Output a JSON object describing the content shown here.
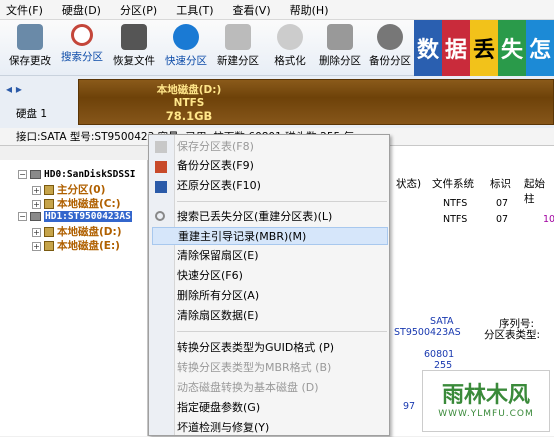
{
  "menu": [
    "文件(F)",
    "硬盘(D)",
    "分区(P)",
    "工具(T)",
    "查看(V)",
    "帮助(H)"
  ],
  "toolbar": [
    {
      "label": "保存更改",
      "color": "#6a8aa8"
    },
    {
      "label": "搜索分区",
      "color": "#c4463a"
    },
    {
      "label": "恢复文件",
      "color": "#555"
    },
    {
      "label": "快速分区",
      "color": "#1a7ad4"
    },
    {
      "label": "新建分区",
      "color": "#888"
    },
    {
      "label": "格式化",
      "color": "#999"
    },
    {
      "label": "删除分区",
      "color": "#777"
    },
    {
      "label": "备份分区",
      "color": "#666"
    }
  ],
  "brand": [
    "数",
    "据",
    "丢",
    "失",
    "怎"
  ],
  "disk": {
    "nav": "◂ ▸",
    "label": "硬盘 1",
    "part_name": "本地磁盘(D:)",
    "part_fs": "NTFS",
    "part_size": "78.1GB"
  },
  "infobar": "接口:SATA  型号:ST9500423         容量:          已用:              柱面数:60801  磁头数:255  每",
  "tree": [
    {
      "text": "HD0:SanDiskSDSSI",
      "type": "hdd"
    },
    {
      "text": "主分区(0)",
      "type": "part"
    },
    {
      "text": "本地磁盘(C:)",
      "type": "part"
    },
    {
      "text": "HD1:ST9500423AS",
      "type": "hdd"
    },
    {
      "text": "本地磁盘(D:)",
      "type": "part"
    },
    {
      "text": "本地磁盘(E:)",
      "type": "part"
    }
  ],
  "columns": [
    "状态)",
    "文件系统",
    "标识",
    "起始柱"
  ],
  "rows": [
    [
      "NTFS",
      "07",
      ""
    ],
    [
      "NTFS",
      "07",
      "10"
    ]
  ],
  "details": {
    "iface": "SATA",
    "model": "ST9500423AS",
    "serial_label": "序列号:",
    "ptable_label": "分区表类型:",
    "cyl": "60801",
    "heads": "255",
    "v97": "97"
  },
  "context_menu": [
    {
      "label": "保存分区表(F8)",
      "disabled": true
    },
    {
      "label": "备份分区表(F9)"
    },
    {
      "label": "还原分区表(F10)"
    },
    {
      "sep": true
    },
    {
      "label": "搜索已丢失分区(重建分区表)(L)"
    },
    {
      "label": "重建主引导记录(MBR)(M)",
      "hl": true
    },
    {
      "label": "清除保留扇区(E)"
    },
    {
      "label": "快速分区(F6)"
    },
    {
      "label": "删除所有分区(A)"
    },
    {
      "label": "清除扇区数据(E)"
    },
    {
      "sep": true
    },
    {
      "label": "转换分区表类型为GUID格式 (P)"
    },
    {
      "label": "转换分区表类型为MBR格式 (B)",
      "disabled": true
    },
    {
      "label": "动态磁盘转换为基本磁盘 (D)",
      "disabled": true
    },
    {
      "label": "指定硬盘参数(G)"
    },
    {
      "label": "坏道检测与修复(Y)"
    }
  ],
  "watermark": {
    "title": "雨林木风",
    "url": "WWW.YLMFU.COM"
  }
}
